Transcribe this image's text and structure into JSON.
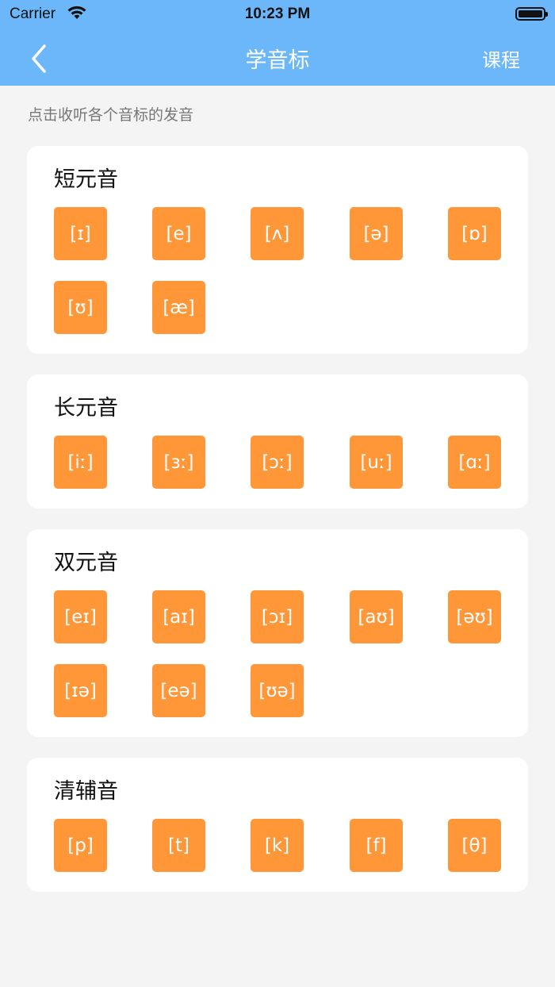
{
  "status_bar": {
    "carrier": "Carrier",
    "time": "10:23 PM"
  },
  "nav": {
    "title": "学音标",
    "right_label": "课程",
    "back_icon": "chevron-left-icon"
  },
  "hint": "点击收听各个音标的发音",
  "colors": {
    "nav_bg": "#6bb7fa",
    "button_bg": "#ff9638",
    "page_bg": "#f4f4f4"
  },
  "sections": [
    {
      "title": "短元音",
      "symbols": [
        "[ɪ]",
        "[e]",
        "[ʌ]",
        "[ə]",
        "[ɒ]",
        "[ʊ]",
        "[æ]"
      ]
    },
    {
      "title": "长元音",
      "symbols": [
        "[iː]",
        "[ɜː]",
        "[ɔː]",
        "[uː]",
        "[ɑː]"
      ]
    },
    {
      "title": "双元音",
      "symbols": [
        "[eɪ]",
        "[aɪ]",
        "[ɔɪ]",
        "[aʊ]",
        "[əʊ]",
        "[ɪə]",
        "[eə]",
        "[ʊə]"
      ]
    },
    {
      "title": "清辅音",
      "symbols": [
        "[p]",
        "[t]",
        "[k]",
        "[f]",
        "[θ]"
      ]
    }
  ]
}
